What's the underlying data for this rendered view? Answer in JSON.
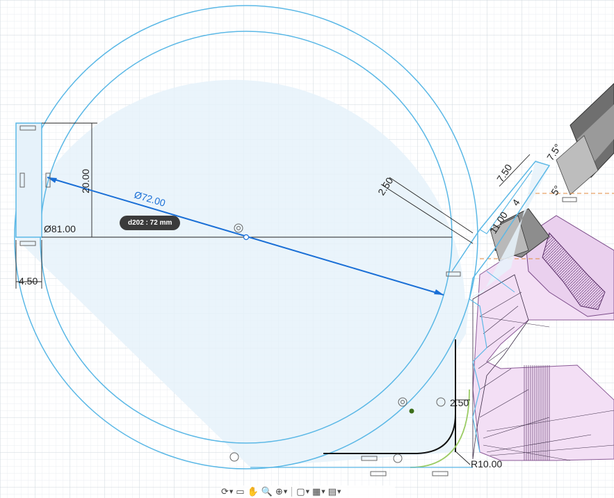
{
  "dimensions": {
    "d_outer": "Ø81.00",
    "d_inner": "Ø72.00",
    "height_20": "20.00",
    "width_4_50": "4.50",
    "offset_2_50_top": "2.50",
    "len_7_50": "7.50",
    "len_11_00": "11.00",
    "len_4": "4",
    "angle_7_5": "7.5°",
    "angle_5": "5°",
    "offset_2_50_bottom": "2.50",
    "radius_10": "R10.00"
  },
  "tooltip": {
    "text": "d202 : 72 mm"
  },
  "toolbar": {
    "items": [
      {
        "name": "orbit-icon",
        "glyph": "⟳"
      },
      {
        "name": "look-at-icon",
        "glyph": "▭"
      },
      {
        "name": "pan-icon",
        "glyph": "✋"
      },
      {
        "name": "zoom-icon",
        "glyph": "🔍"
      },
      {
        "name": "fit-icon",
        "glyph": "⊕"
      },
      {
        "name": "display-settings-icon",
        "glyph": "▢"
      },
      {
        "name": "grid-settings-icon",
        "glyph": "▦"
      },
      {
        "name": "viewports-icon",
        "glyph": "▤"
      }
    ]
  },
  "colors": {
    "sketch_blue": "#5bb8e6",
    "fill_blue": "#e6f2fa",
    "selected_blue": "#1a6fd6",
    "grid": "#dde3e8",
    "body_pink": "#f1d9f2",
    "curve_green": "#9ccc65"
  }
}
